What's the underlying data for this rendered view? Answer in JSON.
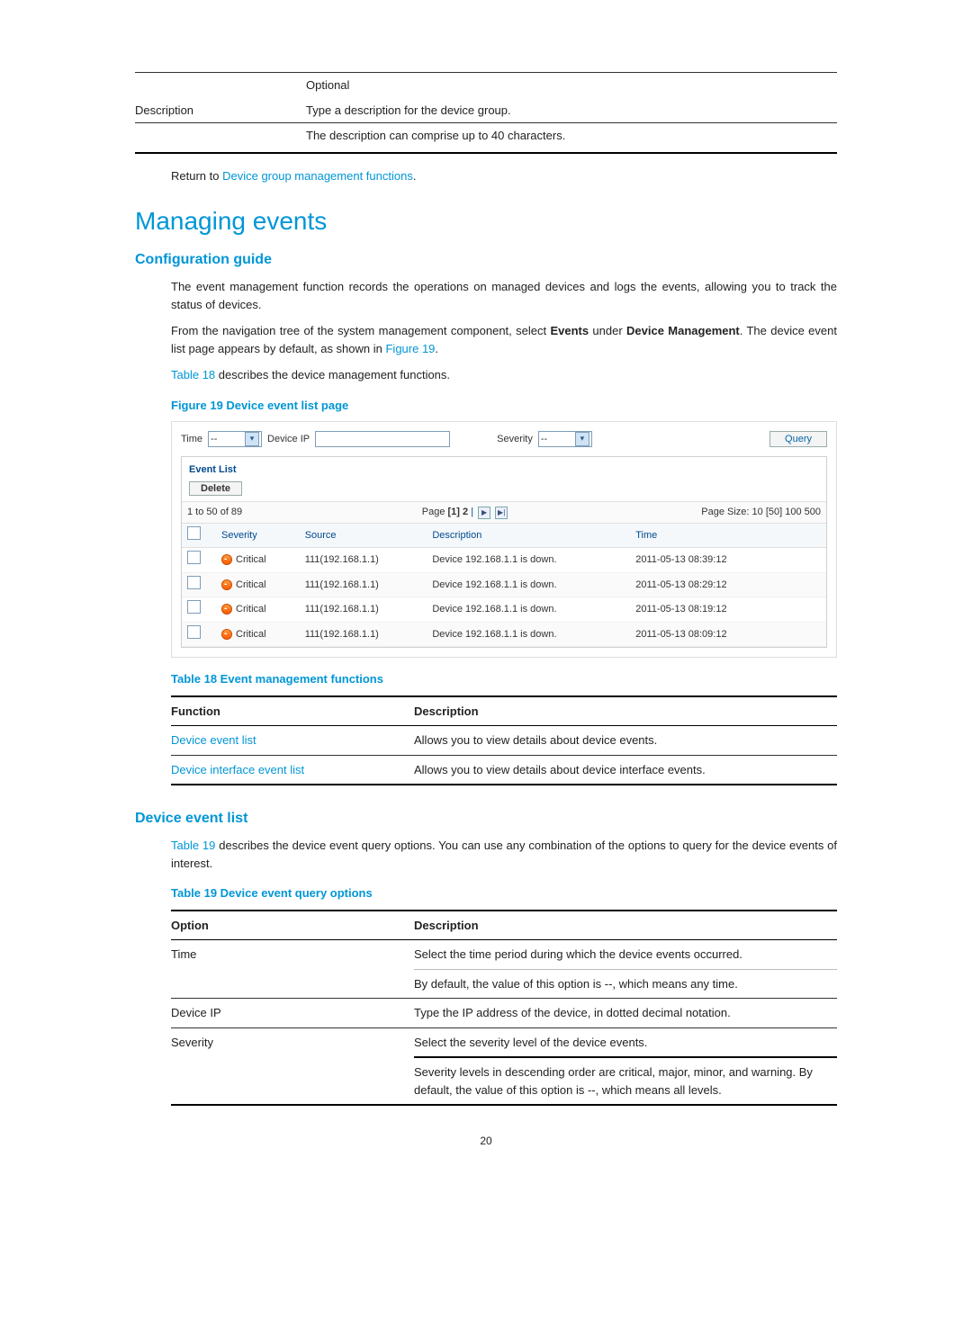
{
  "top_table": {
    "optional": "Optional",
    "row_label": "Description",
    "line1": "Type a description for the device group.",
    "line2": "The description can comprise up to 40 characters."
  },
  "return_line": {
    "prefix": "Return to ",
    "link": "Device group management functions",
    "suffix": "."
  },
  "h1": "Managing events",
  "config_guide": {
    "heading": "Configuration guide",
    "p1": "The event management function records the operations on managed devices and logs the events, allowing you to track the status of devices.",
    "p2a": "From the navigation tree of the system management component, select ",
    "p2b_bold": "Events",
    "p2c": " under ",
    "p2d_bold": "Device Management",
    "p2e": ". The device event list page appears by default, as shown in ",
    "p2_link": "Figure 19",
    "p2f": ".",
    "p3_link": "Table 18",
    "p3_rest": " describes the device management functions."
  },
  "figure19": {
    "caption": "Figure 19 Device event list page",
    "filter": {
      "time_label": "Time",
      "time_value": "--",
      "device_ip_label": "Device IP",
      "device_ip_value": "",
      "severity_label": "Severity",
      "severity_value": "--",
      "query_btn": "Query"
    },
    "list_title": "Event List",
    "delete_btn": "Delete",
    "count_text": "1 to 50 of 89",
    "page_label": "Page ",
    "page_numbers": "[1] 2",
    "page_size_label": "Page Size: ",
    "page_sizes": "10 [50] 100 500",
    "headers": {
      "severity": "Severity",
      "source": "Source",
      "description": "Description",
      "time": "Time"
    },
    "rows": [
      {
        "severity": "Critical",
        "source": "111(192.168.1.1)",
        "description": "Device 192.168.1.1 is down.",
        "time": "2011-05-13 08:39:12"
      },
      {
        "severity": "Critical",
        "source": "111(192.168.1.1)",
        "description": "Device 192.168.1.1 is down.",
        "time": "2011-05-13 08:29:12"
      },
      {
        "severity": "Critical",
        "source": "111(192.168.1.1)",
        "description": "Device 192.168.1.1 is down.",
        "time": "2011-05-13 08:19:12"
      },
      {
        "severity": "Critical",
        "source": "111(192.168.1.1)",
        "description": "Device 192.168.1.1 is down.",
        "time": "2011-05-13 08:09:12"
      }
    ]
  },
  "table18": {
    "caption": "Table 18 Event management functions",
    "hdr_function": "Function",
    "hdr_description": "Description",
    "rows": [
      {
        "fn": "Device event list",
        "desc": "Allows you to view details about device events."
      },
      {
        "fn": "Device interface event list",
        "desc": "Allows you to view details about device interface events."
      }
    ]
  },
  "device_event_list": {
    "heading": "Device event list",
    "p1_link": "Table 19",
    "p1_rest": " describes the device event query options. You can use any combination of the options to query for the device events of interest."
  },
  "table19": {
    "caption": "Table 19 Device event query options",
    "hdr_option": "Option",
    "hdr_description": "Description",
    "rows": [
      {
        "opt": "Time",
        "d1": "Select the time period during which the device events occurred.",
        "d2": "By default, the value of this option is --, which means any time."
      },
      {
        "opt": "Device IP",
        "d1": "Type the IP address of the device, in dotted decimal notation."
      },
      {
        "opt": "Severity",
        "d1": "Select the severity level of the device events.",
        "d2": "Severity levels in descending order are critical, major, minor, and warning. By default, the value of this option is --, which means all levels."
      }
    ]
  },
  "page_number": "20"
}
